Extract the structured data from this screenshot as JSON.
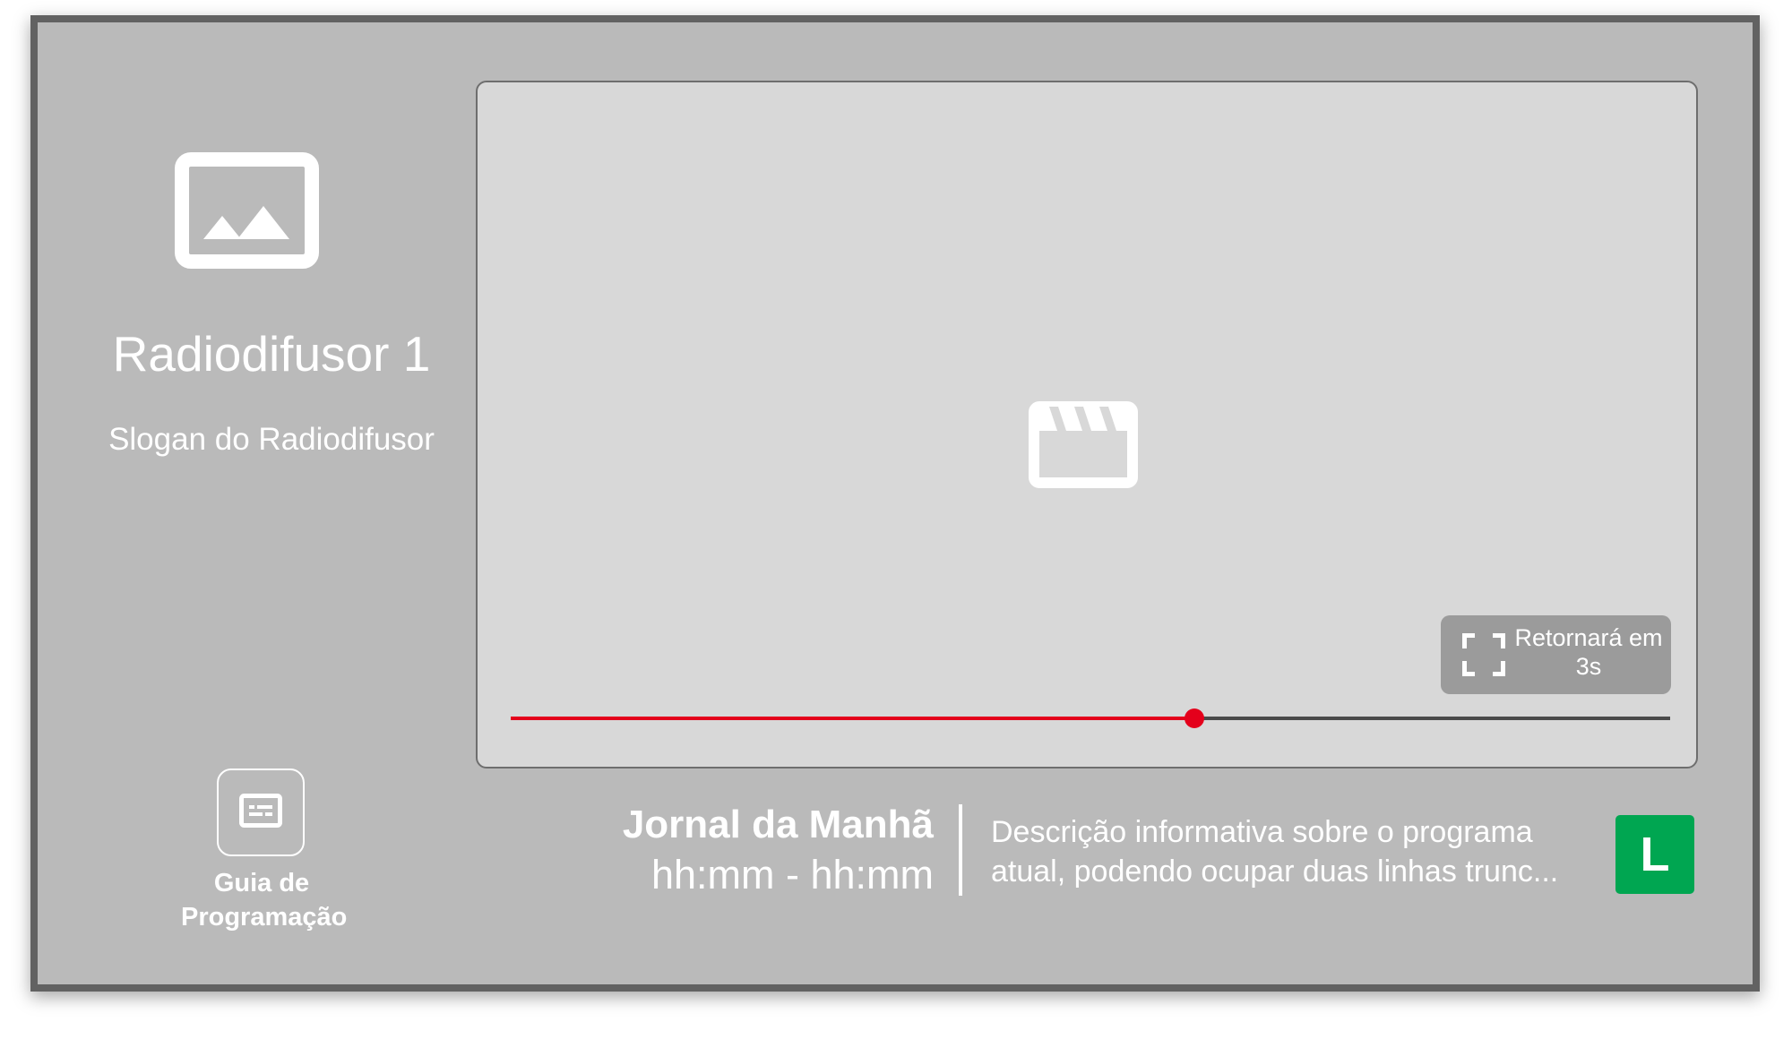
{
  "channel": {
    "logo_icon": "image-placeholder-icon",
    "name": "Radiodifusor 1",
    "slogan": "Slogan do Radiodifusor"
  },
  "guide": {
    "icon": "subtitles-icon",
    "label": "Guia de Programação"
  },
  "player": {
    "placeholder_icon": "clapperboard-icon",
    "progress_percent": 59,
    "progress_color": "#e4001b",
    "return_chip": {
      "icon": "fullscreen-icon",
      "text": "Retornará em 3s"
    }
  },
  "program": {
    "title": "Jornal da Manhã",
    "time": "hh:mm - hh:mm",
    "description": "Descrição informativa sobre o programa atual, podendo ocupar duas linhas trunc...",
    "rating": "L",
    "rating_color": "#00a651"
  }
}
